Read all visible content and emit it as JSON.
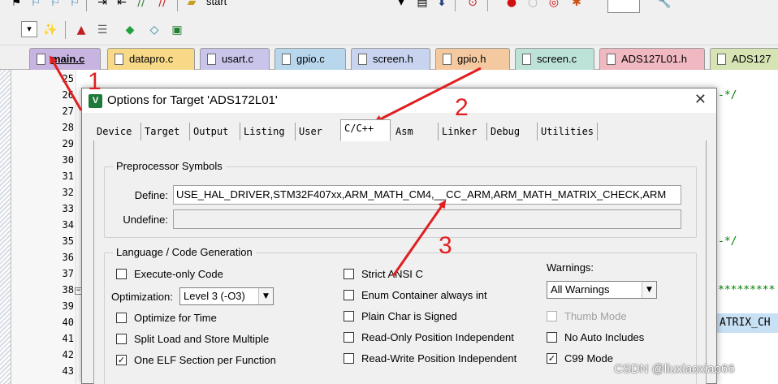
{
  "toolbar": {
    "target_name": "start"
  },
  "file_tabs": [
    {
      "label": "main.c",
      "color": "#c8b4e0",
      "active": true
    },
    {
      "label": "datapro.c",
      "color": "#f7d988"
    },
    {
      "label": "usart.c",
      "color": "#c9c4ea"
    },
    {
      "label": "gpio.c",
      "color": "#b8d6ec"
    },
    {
      "label": "screen.h",
      "color": "#c7d3ef"
    },
    {
      "label": "gpio.h",
      "color": "#f5c9a0"
    },
    {
      "label": "screen.c",
      "color": "#bde3d8"
    },
    {
      "label": "ADS127L01.h",
      "color": "#f0b8c0"
    },
    {
      "label": "ADS127",
      "color": "#d6e4b4"
    }
  ],
  "editor": {
    "line_numbers": [
      "25",
      "26",
      "27",
      "28",
      "29",
      "30",
      "31",
      "32",
      "33",
      "34",
      "35",
      "36",
      "37",
      "38",
      "39",
      "40",
      "41",
      "42",
      "43"
    ],
    "fragments": {
      "comment1": "-*/",
      "comment2": "-*/",
      "stars": "*********",
      "highlight": "ATRIX_CH"
    }
  },
  "dialog": {
    "title": "Options for Target 'ADS172L01'",
    "tabs": [
      "Device",
      "Target",
      "Output",
      "Listing",
      "User",
      "C/C++",
      "Asm",
      "Linker",
      "Debug",
      "Utilities"
    ],
    "active_tab": "C/C++",
    "preprocessor": {
      "group_title": "Preprocessor Symbols",
      "define_label": "Define:",
      "define_value": "USE_HAL_DRIVER,STM32F407xx,ARM_MATH_CM4,__CC_ARM,ARM_MATH_MATRIX_CHECK,ARM",
      "undefine_label": "Undefine:",
      "undefine_value": ""
    },
    "language": {
      "group_title": "Language / Code Generation",
      "execute_only": {
        "label": "Execute-only Code",
        "checked": false
      },
      "optimization_label": "Optimization:",
      "optimization_value": "Level 3 (-O3)",
      "optimize_time": {
        "label": "Optimize for Time",
        "checked": false
      },
      "split_load": {
        "label": "Split Load and Store Multiple",
        "checked": false
      },
      "one_elf": {
        "label": "One ELF Section per Function",
        "checked": true
      },
      "strict_ansi": {
        "label": "Strict ANSI C",
        "checked": false
      },
      "enum_int": {
        "label": "Enum Container always int",
        "checked": false
      },
      "plain_char": {
        "label": "Plain Char is Signed",
        "checked": false
      },
      "ro_pi": {
        "label": "Read-Only Position Independent",
        "checked": false
      },
      "rw_pi": {
        "label": "Read-Write Position Independent",
        "checked": false
      },
      "warnings_label": "Warnings:",
      "warnings_value": "All Warnings",
      "thumb_mode": {
        "label": "Thumb Mode",
        "checked": false,
        "disabled": true
      },
      "no_auto_includes": {
        "label": "No Auto Includes",
        "checked": false
      },
      "c99_mode": {
        "label": "C99 Mode",
        "checked": true
      }
    }
  },
  "annotations": {
    "n1": "1",
    "n2": "2",
    "n3": "3",
    "arrow_color": "#e02020"
  },
  "watermark": "CSDN @liuxiaoxiao66"
}
